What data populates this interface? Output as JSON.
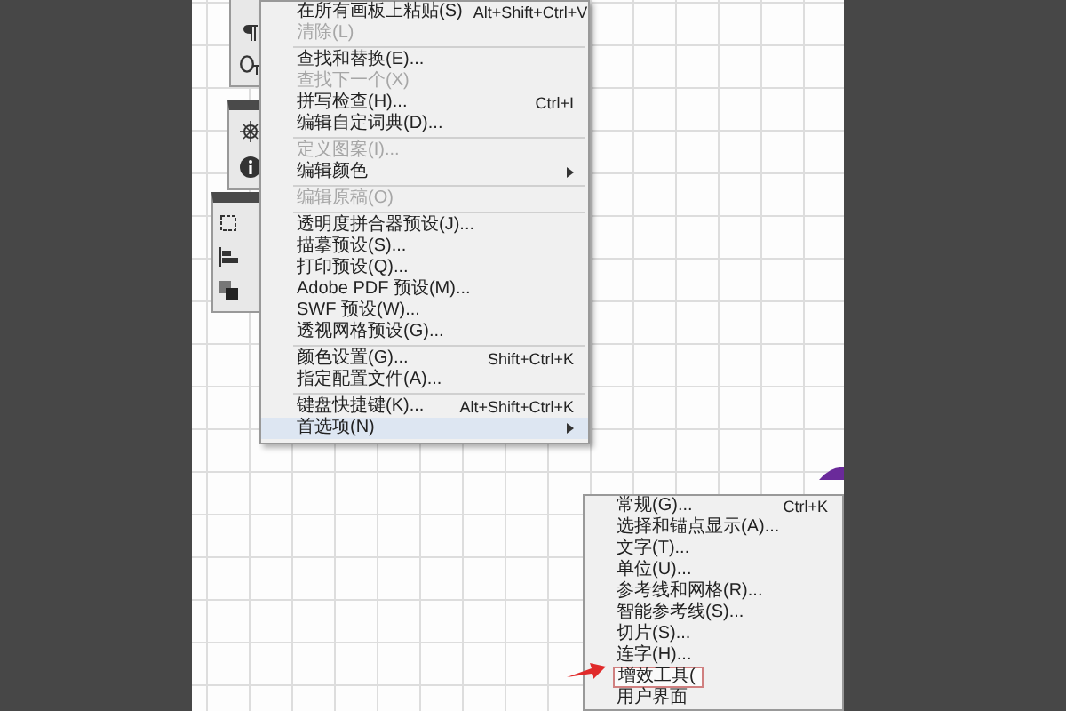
{
  "menu": {
    "items": [
      {
        "kind": "item",
        "label": "在所有画板上粘贴(S)",
        "shortcut": "Alt+Shift+Ctrl+V",
        "disabled": false,
        "submenu": false,
        "selected": false
      },
      {
        "kind": "item",
        "label": "清除(L)",
        "disabled": true,
        "submenu": false,
        "selected": false
      },
      {
        "kind": "separator"
      },
      {
        "kind": "item",
        "label": "查找和替换(E)...",
        "disabled": false,
        "submenu": false,
        "selected": false
      },
      {
        "kind": "item",
        "label": "查找下一个(X)",
        "disabled": true,
        "submenu": false,
        "selected": false
      },
      {
        "kind": "item",
        "label": "拼写检查(H)...",
        "shortcut": "Ctrl+I",
        "disabled": false,
        "submenu": false,
        "selected": false
      },
      {
        "kind": "item",
        "label": "编辑自定词典(D)...",
        "disabled": false,
        "submenu": false,
        "selected": false
      },
      {
        "kind": "separator"
      },
      {
        "kind": "item",
        "label": "定义图案(I)...",
        "disabled": true,
        "submenu": false,
        "selected": false
      },
      {
        "kind": "item",
        "label": "编辑颜色",
        "disabled": false,
        "submenu": true,
        "selected": false
      },
      {
        "kind": "separator"
      },
      {
        "kind": "item",
        "label": "编辑原稿(O)",
        "disabled": true,
        "submenu": false,
        "selected": false
      },
      {
        "kind": "separator"
      },
      {
        "kind": "item",
        "label": "透明度拼合器预设(J)...",
        "disabled": false,
        "submenu": false,
        "selected": false
      },
      {
        "kind": "item",
        "label": "描摹预设(S)...",
        "disabled": false,
        "submenu": false,
        "selected": false
      },
      {
        "kind": "item",
        "label": "打印预设(Q)...",
        "disabled": false,
        "submenu": false,
        "selected": false
      },
      {
        "kind": "item",
        "label": "Adobe PDF 预设(M)...",
        "disabled": false,
        "submenu": false,
        "selected": false
      },
      {
        "kind": "item",
        "label": "SWF 预设(W)...",
        "disabled": false,
        "submenu": false,
        "selected": false
      },
      {
        "kind": "item",
        "label": "透视网格预设(G)...",
        "disabled": false,
        "submenu": false,
        "selected": false
      },
      {
        "kind": "separator"
      },
      {
        "kind": "item",
        "label": "颜色设置(G)...",
        "shortcut": "Shift+Ctrl+K",
        "disabled": false,
        "submenu": false,
        "selected": false
      },
      {
        "kind": "item",
        "label": "指定配置文件(A)...",
        "disabled": false,
        "submenu": false,
        "selected": false
      },
      {
        "kind": "separator"
      },
      {
        "kind": "item",
        "label": "键盘快捷键(K)...",
        "shortcut": "Alt+Shift+Ctrl+K",
        "disabled": false,
        "submenu": false,
        "selected": false
      },
      {
        "kind": "item",
        "label": "首选项(N)",
        "disabled": false,
        "submenu": true,
        "selected": true
      }
    ]
  },
  "submenu": {
    "items": [
      {
        "label": "常规(G)...",
        "shortcut": "Ctrl+K",
        "outlined": false
      },
      {
        "label": "选择和锚点显示(A)...",
        "outlined": false
      },
      {
        "label": "文字(T)...",
        "outlined": false
      },
      {
        "label": "单位(U)...",
        "outlined": false
      },
      {
        "label": "参考线和网格(R)...",
        "outlined": false
      },
      {
        "label": "智能参考线(S)...",
        "outlined": false
      },
      {
        "label": "切片(S)...",
        "outlined": false
      },
      {
        "label": "连字(H)...",
        "outlined": false
      },
      {
        "label": "增效工具(",
        "outlined": true
      },
      {
        "label": "用户界面",
        "outlined": false
      }
    ]
  }
}
